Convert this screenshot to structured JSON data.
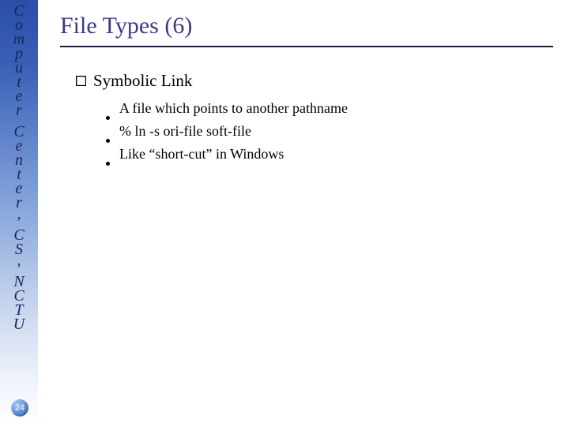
{
  "sidebar": {
    "org_text": "Computer Center, CS, NCTU",
    "chars": [
      "C",
      "o",
      "m",
      "p",
      "u",
      "t",
      "e",
      "r",
      " ",
      "C",
      "e",
      "n",
      "t",
      "e",
      "r",
      ",",
      " ",
      "C",
      "S",
      ",",
      " ",
      "N",
      "C",
      "T",
      "U"
    ]
  },
  "page_number": "24",
  "title": "File Types (6)",
  "section": {
    "heading": "Symbolic Link",
    "bullets": [
      "A file which points to another pathname",
      "% ln -s ori-file soft-file",
      "Like “short-cut” in Windows"
    ]
  }
}
